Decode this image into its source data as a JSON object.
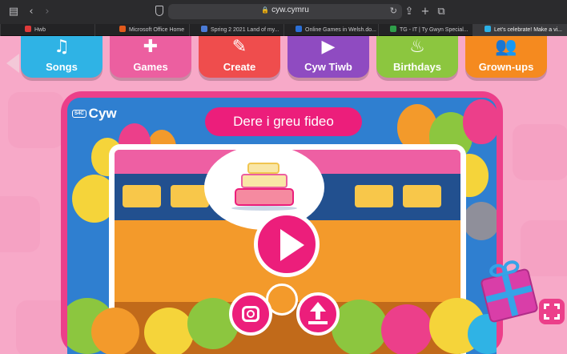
{
  "browser": {
    "url": "cyw.cymru",
    "tabs": [
      {
        "label": "Hwb",
        "favicon_color": "#e03a3a"
      },
      {
        "label": "Microsoft Office Home",
        "favicon_color": "#e25a1c"
      },
      {
        "label": "Spring 2 2021 Land of my...",
        "favicon_color": "#4b7bd6"
      },
      {
        "label": "Online Games in Welsh.do...",
        "favicon_color": "#2b6fd6"
      },
      {
        "label": "TG - IT | Ty Gwyn Special...",
        "favicon_color": "#2e9e4a"
      },
      {
        "label": "Let's celebrate! Make a vi...",
        "favicon_color": "#2bb0e6"
      }
    ]
  },
  "nav": [
    {
      "label": "Songs",
      "icon": "music-note-icon",
      "glyph": "♫",
      "color": "#2fb3e5"
    },
    {
      "label": "Games",
      "icon": "puzzle-icon",
      "glyph": "✚",
      "color": "#ec5fa0"
    },
    {
      "label": "Create",
      "icon": "pencil-icon",
      "glyph": "✎",
      "color": "#ef4d4d"
    },
    {
      "label": "Cyw Tiwb",
      "icon": "play-icon",
      "glyph": "▶",
      "color": "#8f4bc1"
    },
    {
      "label": "Birthdays",
      "icon": "cake-icon",
      "glyph": "♨",
      "color": "#8cc63f"
    },
    {
      "label": "Grown-ups",
      "icon": "people-icon",
      "glyph": "👥",
      "color": "#f58a1f"
    }
  ],
  "game": {
    "logo": "Cyw",
    "logo_tag": "S4C",
    "title": "Dere i greu fideo"
  }
}
